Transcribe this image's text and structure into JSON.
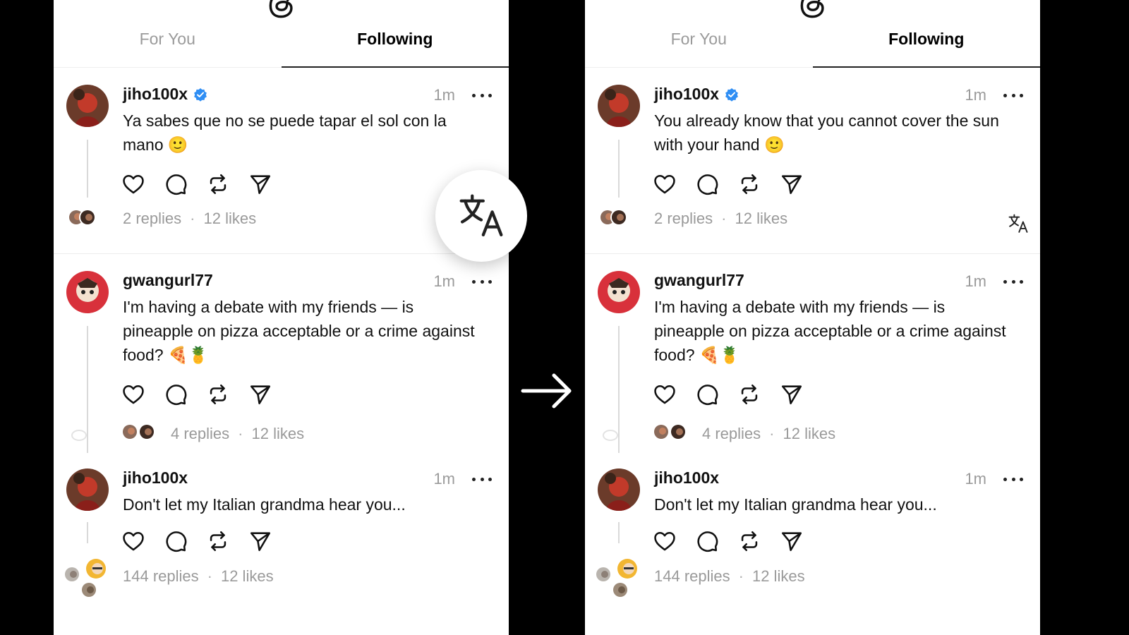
{
  "left_panel": {
    "tabs": [
      {
        "label": "For You",
        "active": false
      },
      {
        "label": "Following",
        "active": true
      }
    ],
    "posts": [
      {
        "username": "jiho100x",
        "verified": true,
        "time": "1m",
        "text": "Ya sabes que no se puede tapar el sol con la mano 🙂",
        "replies": "2 replies",
        "likes": "12 likes"
      },
      {
        "username": "gwangurl77",
        "verified": false,
        "time": "1m",
        "text": "I'm having a debate with my friends — is pineapple on pizza acceptable or a crime against food? 🍕🍍",
        "replies": "4 replies",
        "likes": "12 likes"
      },
      {
        "username": "jiho100x",
        "verified": false,
        "time": "1m",
        "text": "Don't let my Italian grandma hear you...",
        "replies": "144 replies",
        "likes": "12 likes"
      }
    ]
  },
  "right_panel": {
    "tabs": [
      {
        "label": "For You",
        "active": false
      },
      {
        "label": "Following",
        "active": true
      }
    ],
    "posts": [
      {
        "username": "jiho100x",
        "verified": true,
        "time": "1m",
        "text": "You already know that you cannot cover the sun with your hand 🙂",
        "replies": "2 replies",
        "likes": "12 likes"
      },
      {
        "username": "gwangurl77",
        "verified": false,
        "time": "1m",
        "text": "I'm having a debate with my friends — is pineapple on pizza acceptable or a crime against food? 🍕🍍",
        "replies": "4 replies",
        "likes": "12 likes"
      },
      {
        "username": "jiho100x",
        "verified": false,
        "time": "1m",
        "text": "Don't let my Italian grandma hear you...",
        "replies": "144 replies",
        "likes": "12 likes"
      }
    ]
  },
  "separator": "·",
  "icons": {
    "logo": "threads-logo-icon",
    "like": "heart-icon",
    "reply": "comment-icon",
    "repost": "repost-icon",
    "share": "send-icon",
    "translate": "translate-icon",
    "more": "more-icon",
    "transition": "arrow-right-icon"
  },
  "colors": {
    "verified": "#2f8ef4",
    "muted": "#9a9a9a",
    "background": "#000000"
  }
}
